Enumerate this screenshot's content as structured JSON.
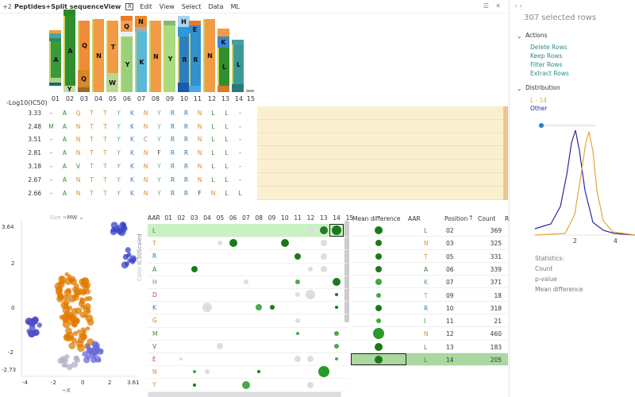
{
  "menubar": {
    "prefix": "+2",
    "title": "Peptides+Split sequenceView",
    "close": "X",
    "items": [
      "Edit",
      "View",
      "Select",
      "Data",
      "ML"
    ]
  },
  "logo": {
    "positions": [
      "01",
      "02",
      "03",
      "04",
      "05",
      "06",
      "07",
      "08",
      "09",
      "10",
      "11",
      "12",
      "13",
      "14",
      "15"
    ],
    "letters": [
      "A",
      "A",
      "Q",
      "N",
      "T",
      "Q",
      "N",
      "Y",
      "R",
      "R",
      "N",
      "K",
      "L",
      "L",
      ""
    ]
  },
  "grid": {
    "column_header": "-Log10(IC50)",
    "rows": [
      {
        "value": "3.33",
        "cells": [
          "-",
          "A",
          "Q",
          "T",
          "T",
          "Y",
          "K",
          "N",
          "Y",
          "R",
          "R",
          "N",
          "L",
          "L",
          "-"
        ]
      },
      {
        "value": "2.48",
        "cells": [
          "M",
          "A",
          "N",
          "T",
          "T",
          "Y",
          "K",
          "N",
          "Y",
          "R",
          "R",
          "N",
          "L",
          "L",
          "-"
        ]
      },
      {
        "value": "3.51",
        "cells": [
          "-",
          "A",
          "N",
          "T",
          "T",
          "Y",
          "K",
          "C",
          "Y",
          "R",
          "R",
          "N",
          "L",
          "L",
          "-"
        ]
      },
      {
        "value": "2.81",
        "cells": [
          "-",
          "A",
          "N",
          "T",
          "T",
          "Y",
          "K",
          "N",
          "F",
          "R",
          "R",
          "N",
          "L",
          "L",
          "-"
        ]
      },
      {
        "value": "3.18",
        "cells": [
          "-",
          "A",
          "V",
          "T",
          "T",
          "Y",
          "K",
          "N",
          "Y",
          "R",
          "R",
          "N",
          "L",
          "L",
          "-"
        ]
      },
      {
        "value": "2.67",
        "cells": [
          "-",
          "A",
          "N",
          "T",
          "T",
          "Y",
          "K",
          "N",
          "Y",
          "R",
          "R",
          "N",
          "L",
          "L",
          "-"
        ]
      },
      {
        "value": "2.66",
        "cells": [
          "-",
          "A",
          "N",
          "T",
          "T",
          "Y",
          "K",
          "N",
          "Y",
          "R",
          "R",
          "F",
          "N",
          "L",
          "L"
        ]
      }
    ]
  },
  "scatter": {
    "size_label": "Size",
    "size_value": "~MW",
    "color_label": "Color",
    "color_value": "IC50Scaled",
    "x_axis_label": "~X",
    "x_ticks": [
      "-4",
      "-2",
      "0",
      "2",
      "3.61"
    ],
    "y_ticks": [
      "3.64",
      "2",
      "0",
      "-2",
      "-2.73"
    ]
  },
  "matrix": {
    "header_label": "AAR",
    "columns": [
      "01",
      "02",
      "03",
      "04",
      "05",
      "06",
      "07",
      "08",
      "09",
      "10",
      "11",
      "12",
      "13",
      "14",
      "15"
    ],
    "rows": [
      "L",
      "T",
      "R",
      "A",
      "H",
      "D",
      "K",
      "G",
      "M",
      "V",
      "E",
      "N",
      "Y"
    ],
    "row_colors": [
      "#3c8a3c",
      "#e08b28",
      "#2a79a8",
      "#2c8b2c",
      "#3aa0a0",
      "#d04040",
      "#3070d0",
      "#bb8800",
      "#3a8a3a",
      "#3a8a3a",
      "#d04040",
      "#e08b28",
      "#e08b28"
    ]
  },
  "table": {
    "headers": [
      "Mean difference",
      "AAR",
      "Position",
      "Count",
      "R"
    ],
    "rows": [
      {
        "aar": "L",
        "position": "02",
        "count": "369"
      },
      {
        "aar": "N",
        "position": "03",
        "count": "325"
      },
      {
        "aar": "T",
        "position": "05",
        "count": "331"
      },
      {
        "aar": "A",
        "position": "06",
        "count": "339"
      },
      {
        "aar": "K",
        "position": "07",
        "count": "371"
      },
      {
        "aar": "T",
        "position": "09",
        "count": "18"
      },
      {
        "aar": "R",
        "position": "10",
        "count": "318"
      },
      {
        "aar": "I",
        "position": "11",
        "count": "21"
      },
      {
        "aar": "N",
        "position": "12",
        "count": "460"
      },
      {
        "aar": "L",
        "position": "13",
        "count": "183"
      },
      {
        "aar": "L",
        "position": "14",
        "count": "205"
      }
    ]
  },
  "panel": {
    "title": "307 selected rows",
    "actions_header": "Actions",
    "actions": [
      "Delete Rows",
      "Keep Rows",
      "Filter Rows",
      "Extract Rows"
    ],
    "distribution_header": "Distribution",
    "legend": [
      {
        "label": "L - 14",
        "color": "#e8a43a"
      },
      {
        "label": "Other",
        "color": "#2a2aa0"
      }
    ],
    "x_ticks": [
      "2",
      "4"
    ],
    "statistics_header": "Statistics:",
    "stats": [
      "Count",
      "p-value",
      "Mean difference"
    ]
  }
}
